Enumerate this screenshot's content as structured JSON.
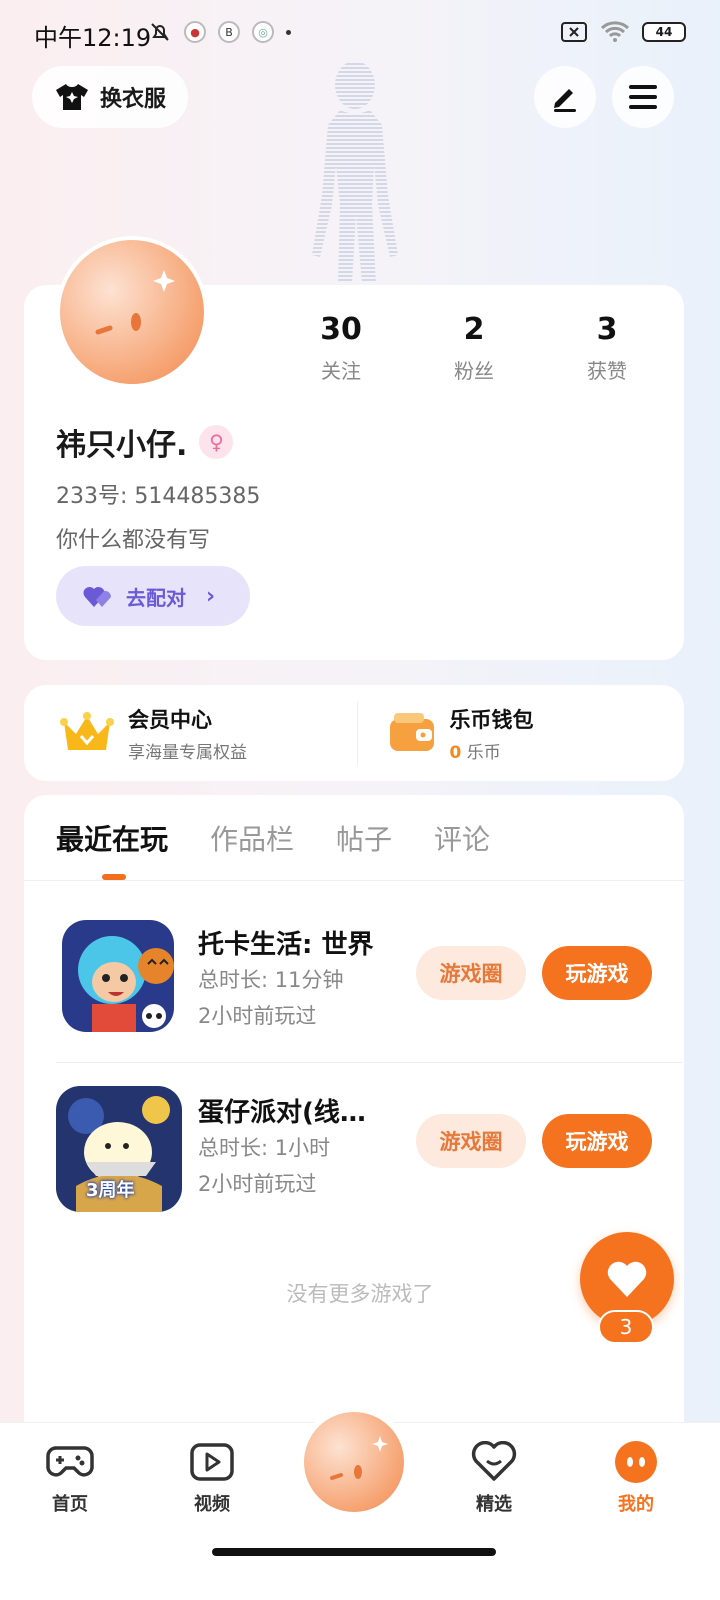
{
  "status_bar": {
    "time": "中午12:19",
    "battery": "44"
  },
  "header": {
    "dress_label": "换衣服"
  },
  "profile": {
    "nickname": "祎只小仔.",
    "uid": "233号: 514485385",
    "bio": "你什么都没有写",
    "match_label": "去配对",
    "stats": [
      {
        "num": "30",
        "label": "关注"
      },
      {
        "num": "2",
        "label": "粉丝"
      },
      {
        "num": "3",
        "label": "获赞"
      }
    ]
  },
  "member": {
    "title": "会员中心",
    "subtitle": "享海量专属权益"
  },
  "wallet": {
    "title": "乐币钱包",
    "amount": "0",
    "unit": "乐币"
  },
  "tabs": [
    "最近在玩",
    "作品栏",
    "帖子",
    "评论"
  ],
  "games": [
    {
      "title": "托卡生活: 世界",
      "duration": "总时长: 11分钟",
      "last_played": "2小时前玩过",
      "circle_label": "游戏圈",
      "play_label": "玩游戏"
    },
    {
      "title": "蛋仔派对(线…",
      "duration": "总时长: 1小时",
      "last_played": "2小时前玩过",
      "circle_label": "游戏圈",
      "play_label": "玩游戏",
      "badge": "3周年"
    }
  ],
  "no_more": "没有更多游戏了",
  "like_count": "3",
  "nav": [
    {
      "label": "首页"
    },
    {
      "label": "视频"
    },
    {
      "label": "精选"
    },
    {
      "label": "我的"
    }
  ],
  "colors": {
    "accent": "#f5731f",
    "match": "#6b5ad6"
  }
}
